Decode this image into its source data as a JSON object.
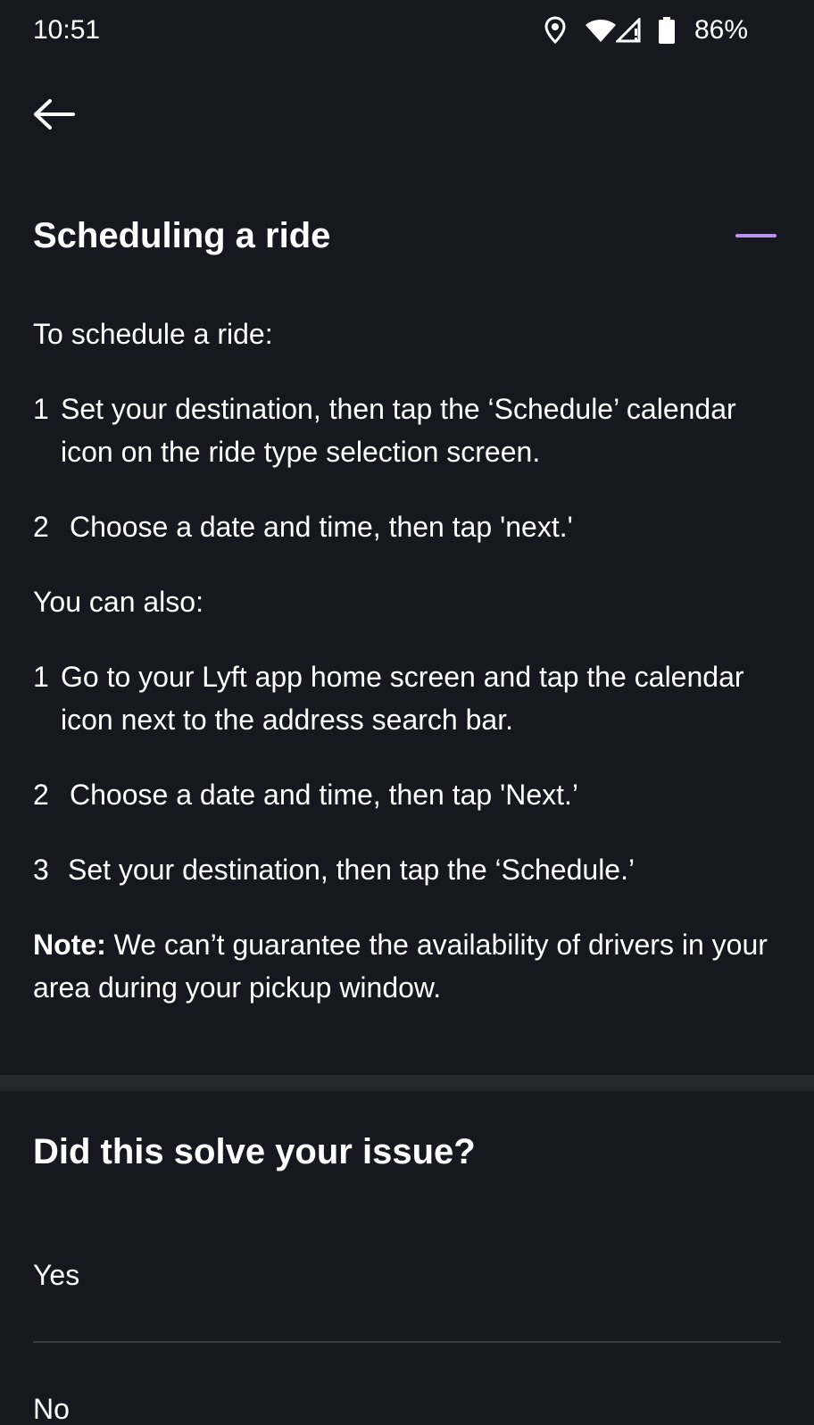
{
  "status_bar": {
    "time": "10:51",
    "battery": "86%",
    "icons": [
      "location-icon",
      "wifi-icon",
      "cellular-signal-icon",
      "battery-icon"
    ]
  },
  "nav": {
    "back_icon": "arrow-left-icon"
  },
  "article": {
    "title": "Scheduling a ride",
    "collapse_icon": "minus-icon",
    "accent_color": "#b791f0",
    "intro": "To schedule a ride:",
    "steps": [
      {
        "num": "1",
        "text": "Set your destination, then tap the ‘Schedule’ calendar icon on the ride type selection screen."
      },
      {
        "num": "2",
        "text": "Choose a date and time, then tap 'next.'"
      }
    ],
    "also_intro": "You can also:",
    "also_steps": [
      {
        "num": "1",
        "text": "Go to your Lyft app home screen and tap the calendar icon next to the address search bar."
      },
      {
        "num": "2",
        "text": "Choose a date and time, then tap 'Next.’"
      },
      {
        "num": "3",
        "text": "Set your destination, then tap the ‘Schedule.’"
      }
    ],
    "note_label": "Note:",
    "note_text": " We can’t guarantee the availability of drivers in your area during your pickup window."
  },
  "feedback": {
    "title": "Did this solve your issue?",
    "options": [
      "Yes",
      "No"
    ]
  },
  "colors": {
    "background": "#17181f",
    "divider_band": "#26272e",
    "text": "#ffffff"
  }
}
